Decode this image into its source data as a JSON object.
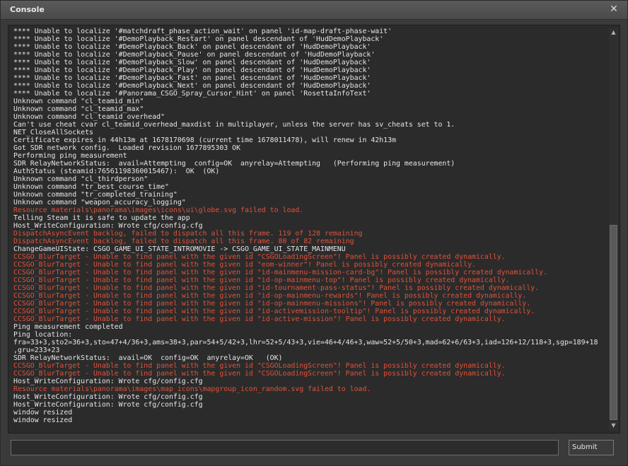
{
  "window": {
    "title": "Console",
    "close_glyph": "✕"
  },
  "console": {
    "lines": [
      {
        "text": "**** Unable to localize '#matchdraft_phase_action_wait' on panel 'id-map-draft-phase-wait'",
        "type": "normal"
      },
      {
        "text": "**** Unable to localize '#DemoPlayback_Restart' on panel descendant of 'HudDemoPlayback'",
        "type": "normal"
      },
      {
        "text": "**** Unable to localize '#DemoPlayback_Back' on panel descendant of 'HudDemoPlayback'",
        "type": "normal"
      },
      {
        "text": "**** Unable to localize '#DemoPlayback_Pause' on panel descendant of 'HudDemoPlayback'",
        "type": "normal"
      },
      {
        "text": "**** Unable to localize '#DemoPlayback_Slow' on panel descendant of 'HudDemoPlayback'",
        "type": "normal"
      },
      {
        "text": "**** Unable to localize '#DemoPlayback_Play' on panel descendant of 'HudDemoPlayback'",
        "type": "normal"
      },
      {
        "text": "**** Unable to localize '#DemoPlayback_Fast' on panel descendant of 'HudDemoPlayback'",
        "type": "normal"
      },
      {
        "text": "**** Unable to localize '#DemoPlayback_Next' on panel descendant of 'HudDemoPlayback'",
        "type": "normal"
      },
      {
        "text": "**** Unable to localize '#Panorama_CSGO_Spray_Cursor_Hint' on panel 'RosettaInfoText'",
        "type": "normal"
      },
      {
        "text": "Unknown command \"cl_teamid_min\"",
        "type": "normal"
      },
      {
        "text": "Unknown command \"cl_teamid_max\"",
        "type": "normal"
      },
      {
        "text": "Unknown command \"cl_teamid_overhead\"",
        "type": "normal"
      },
      {
        "text": "Can't use cheat cvar cl_teamid_overhead_maxdist in multiplayer, unless the server has sv_cheats set to 1.",
        "type": "normal"
      },
      {
        "text": "NET_CloseAllSockets",
        "type": "normal"
      },
      {
        "text": "Certificate expires in 44h13m at 1678170698 (current time 1678011478), will renew in 42h13m",
        "type": "normal"
      },
      {
        "text": "Got SDR network config.  Loaded revision 1677895303 OK",
        "type": "normal"
      },
      {
        "text": "Performing ping measurement",
        "type": "normal"
      },
      {
        "text": "SDR RelayNetworkStatus:  avail=Attempting  config=OK  anyrelay=Attempting   (Performing ping measurement)",
        "type": "normal"
      },
      {
        "text": "AuthStatus (steamid:76561198360015467):  OK  (OK)",
        "type": "normal"
      },
      {
        "text": "Unknown command \"cl_thirdperson\"",
        "type": "normal"
      },
      {
        "text": "Unknown command \"tr_best_course_time\"",
        "type": "normal"
      },
      {
        "text": "Unknown command \"tr_completed_training\"",
        "type": "normal"
      },
      {
        "text": "Unknown command \"weapon_accuracy_logging\"",
        "type": "normal"
      },
      {
        "text": "Resource materials\\panorama\\images\\icons\\ui\\globe.svg failed to load.",
        "type": "error"
      },
      {
        "text": "Telling Steam it is safe to update the app",
        "type": "normal"
      },
      {
        "text": "Host_WriteConfiguration: Wrote cfg/config.cfg",
        "type": "normal"
      },
      {
        "text": "DispatchAsyncEvent backlog, failed to dispatch all this frame. 119 of 128 remaining",
        "type": "error"
      },
      {
        "text": "DispatchAsyncEvent backlog, failed to dispatch all this frame. 80 of 82 remaining",
        "type": "error"
      },
      {
        "text": "ChangeGameUIState: CSGO_GAME_UI_STATE_INTROMOVIE -> CSGO_GAME_UI_STATE_MAINMENU",
        "type": "normal"
      },
      {
        "text": "CCSGO_BlurTarget - Unable to find panel with the given id \"CSGOLoadingScreen\"! Panel is possibly created dynamically.",
        "type": "error"
      },
      {
        "text": "CCSGO_BlurTarget - Unable to find panel with the given id \"eom-winner\"! Panel is possibly created dynamically.",
        "type": "error"
      },
      {
        "text": "CCSGO_BlurTarget - Unable to find panel with the given id \"id-mainmenu-mission-card-bg\"! Panel is possibly created dynamically.",
        "type": "error"
      },
      {
        "text": "CCSGO_BlurTarget - Unable to find panel with the given id \"id-op-mainmenu-top\"! Panel is possibly created dynamically.",
        "type": "error"
      },
      {
        "text": "CCSGO_BlurTarget - Unable to find panel with the given id \"id-tournament-pass-status\"! Panel is possibly created dynamically.",
        "type": "error"
      },
      {
        "text": "CCSGO_BlurTarget - Unable to find panel with the given id \"id-op-mainmenu-rewards\"! Panel is possibly created dynamically.",
        "type": "error"
      },
      {
        "text": "CCSGO_BlurTarget - Unable to find panel with the given id \"id-op-mainmenu-missions\"! Panel is possibly created dynamically.",
        "type": "error"
      },
      {
        "text": "CCSGO_BlurTarget - Unable to find panel with the given id \"id-activemission-tooltip\"! Panel is possibly created dynamically.",
        "type": "error"
      },
      {
        "text": "CCSGO_BlurTarget - Unable to find panel with the given id \"id-active-mission\"! Panel is possibly created dynamically.",
        "type": "error"
      },
      {
        "text": "Ping measurement completed",
        "type": "normal"
      },
      {
        "text": "Ping location:",
        "type": "normal"
      },
      {
        "text": "fra=33+3,sto2=36+3,sto=47+4/36+3,ams=38+3,par=54+5/42+3,lhr=52+5/43+3,vie=46+4/46+3,waw=52+5/50+3,mad=62+6/63+3,iad=126+12/118+3,sgp=189+18",
        "type": "normal"
      },
      {
        "text": ",gru=233+23",
        "type": "normal"
      },
      {
        "text": "SDR RelayNetworkStatus:  avail=OK  config=OK  anyrelay=OK   (OK)",
        "type": "normal"
      },
      {
        "text": "CCSGO_BlurTarget - Unable to find panel with the given id \"CSGOLoadingScreen\"! Panel is possibly created dynamically.",
        "type": "error"
      },
      {
        "text": "CCSGO_BlurTarget - Unable to find panel with the given id \"CSGOLoadingScreen\"! Panel is possibly created dynamically.",
        "type": "error"
      },
      {
        "text": "Host_WriteConfiguration: Wrote cfg/config.cfg",
        "type": "normal"
      },
      {
        "text": "Resource materials\\panorama\\images\\map_icons\\mapgroup_icon_random.svg failed to load.",
        "type": "error"
      },
      {
        "text": "Host_WriteConfiguration: Wrote cfg/config.cfg",
        "type": "normal"
      },
      {
        "text": "Host_WriteConfiguration: Wrote cfg/config.cfg",
        "type": "normal"
      },
      {
        "text": "window resized",
        "type": "normal"
      },
      {
        "text": "window resized",
        "type": "normal"
      }
    ]
  },
  "input": {
    "value": "",
    "placeholder": ""
  },
  "submit_label": "Submit",
  "scrollbar": {
    "up_glyph": "▲",
    "down_glyph": "▼"
  },
  "colors": {
    "normal_text": "#e6e6e6",
    "error_text": "#e0523a",
    "background": "#2b2b2b"
  }
}
